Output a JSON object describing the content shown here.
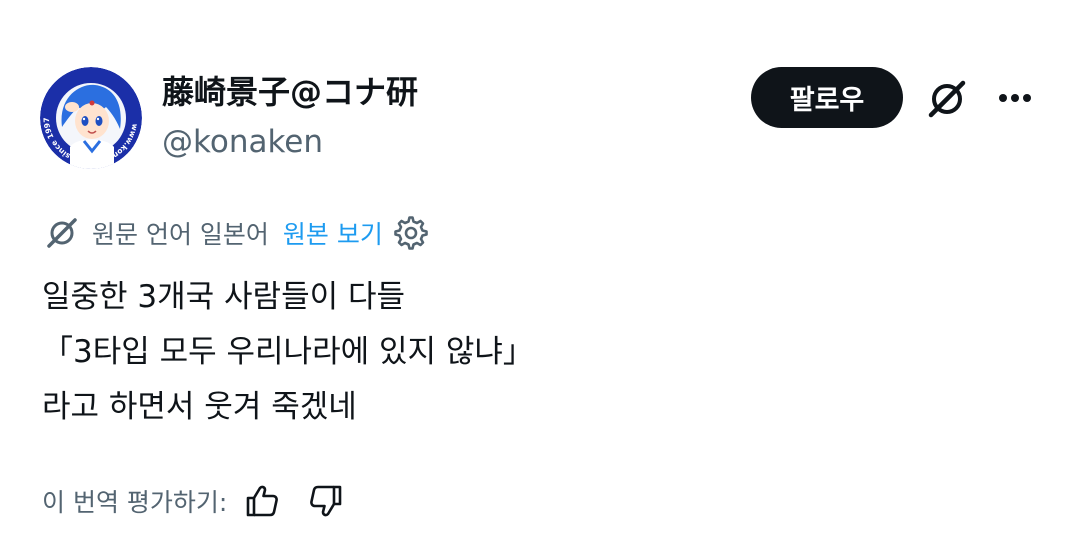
{
  "user": {
    "display_name": "藤崎景子@コナ研",
    "handle": "@konaken",
    "avatar_ring_text": "www.konaken.com since 1997"
  },
  "actions": {
    "follow_label": "팔로우",
    "grok_icon": "grok-icon",
    "more_icon": "more-icon"
  },
  "translation": {
    "source_language_text": "원문 언어 일본어",
    "show_original_label": "원본 보기",
    "settings_icon": "gear-icon"
  },
  "tweet": {
    "lines": [
      "일중한 3개국 사람들이 다들",
      "「3타입 모두 우리나라에 있지 않냐」",
      "라고 하면서 웃겨 죽겠네"
    ]
  },
  "rating": {
    "label": "이 번역 평가하기:",
    "up_icon": "thumbs-up-icon",
    "down_icon": "thumbs-down-icon"
  },
  "colors": {
    "text_primary": "#0f1419",
    "text_secondary": "#536471",
    "link": "#1d9bf0",
    "button_bg": "#0f1419"
  }
}
